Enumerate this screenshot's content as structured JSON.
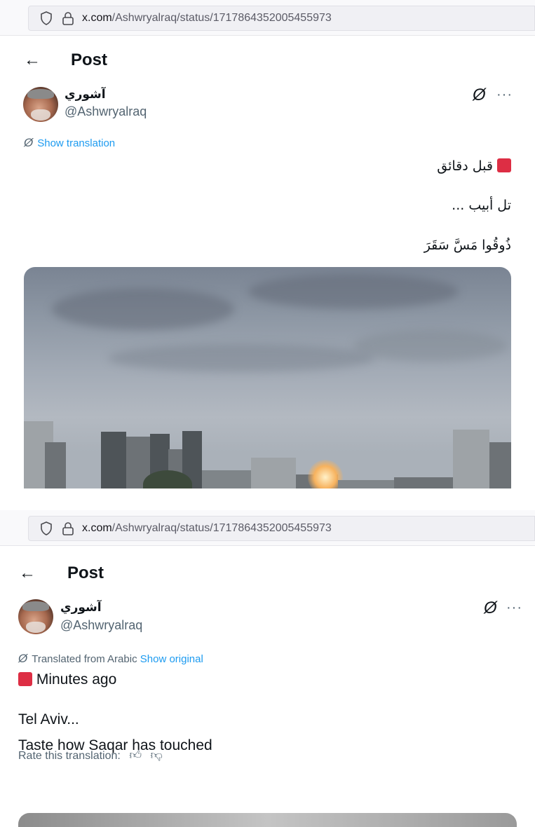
{
  "url": {
    "host": "x.com",
    "path": "/Ashwryalraq/status/1717864352005455973"
  },
  "header": {
    "back_icon": "←",
    "title": "Post"
  },
  "author": {
    "display_name": "آشوري",
    "handle": "@Ashwryalraq"
  },
  "icons": {
    "grok": "Ø",
    "more": "···",
    "thumb_up": "👍︎",
    "thumb_down": "👎︎"
  },
  "original_view": {
    "show_translation": "Show translation",
    "lines": [
      "قبل دقائق",
      "تل أبيب ...",
      "ذُوقُوا مَسَّ سَقَرَ"
    ]
  },
  "translated_view": {
    "translated_from": "Translated from Arabic",
    "show_original": "Show original",
    "lines": [
      "Minutes ago",
      "Tel Aviv...",
      "Taste how Saqar has touched"
    ],
    "rate_label": "Rate this translation:"
  },
  "colors": {
    "link": "#1d9bf0",
    "emoji_red": "#dd2e44",
    "muted": "#536471"
  }
}
